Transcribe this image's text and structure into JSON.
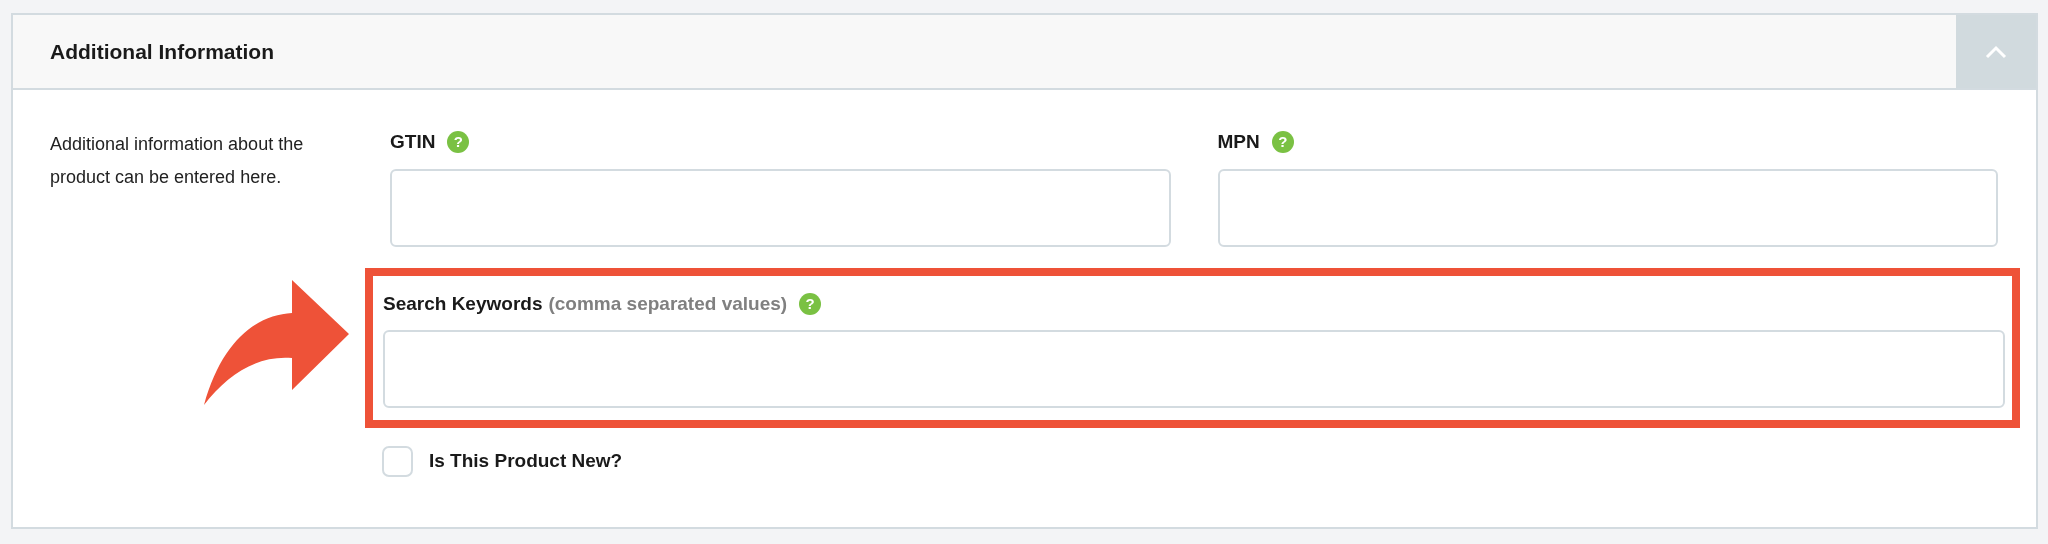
{
  "panel": {
    "title": "Additional Information",
    "expanded": true
  },
  "description": "Additional information about the product can be entered here.",
  "fields": [
    {
      "label": "GTIN",
      "help": "?",
      "highlighted": false
    },
    {
      "label": "MPN",
      "help": "?",
      "highlighted": false
    },
    {
      "label": "Search Keywords",
      "hint": "(comma separated values)",
      "help": "?",
      "highlighted": true
    }
  ],
  "checkbox": {
    "label": "Is This Product New?",
    "checked": false
  }
}
